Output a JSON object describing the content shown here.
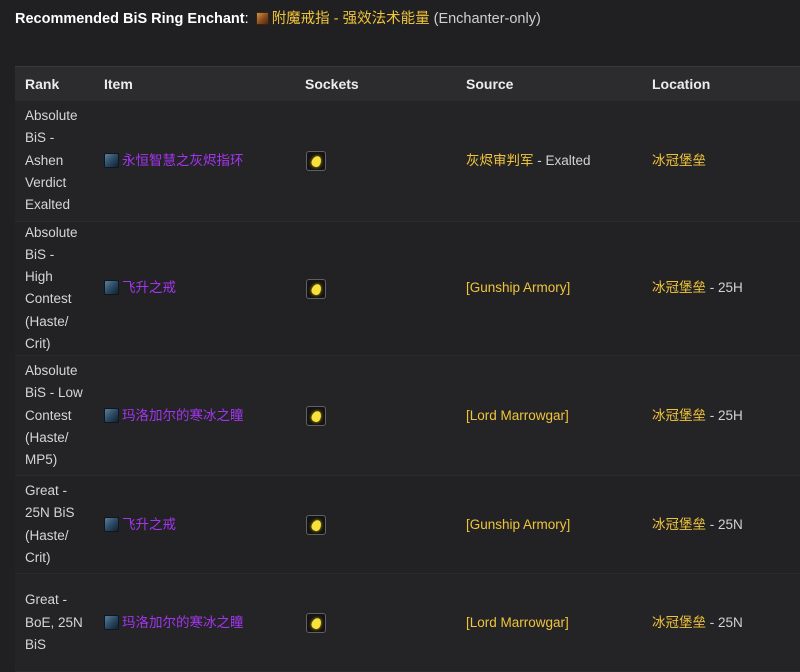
{
  "header": {
    "label": "Recommended BiS Ring Enchant",
    "colon": ":",
    "enchant_name": "附魔戒指 - 强效法术能量",
    "note": "(Enchanter-only)",
    "enchant_icon": "enchant-scroll-icon"
  },
  "table": {
    "columns": [
      "Rank",
      "Item",
      "Sockets",
      "Source",
      "Location"
    ],
    "rows": [
      {
        "rank": "Absolute BiS - Ashen Verdict Exalted",
        "item": "永恒智慧之灰烬指环",
        "socket_icon": "yellow-gem-socket-icon",
        "source_npc": "灰烬审判军",
        "source_rest": " - Exalted",
        "location_zone": "冰冠堡垒",
        "location_rest": ""
      },
      {
        "rank": "Absolute BiS - High Contest (Haste/ Crit)",
        "item": "飞升之戒",
        "socket_icon": "yellow-gem-socket-icon",
        "source_npc": "[Gunship Armory]",
        "source_rest": "",
        "location_zone": "冰冠堡垒",
        "location_rest": " - 25H"
      },
      {
        "rank": "Absolute BiS - Low Contest (Haste/ MP5)",
        "item": "玛洛加尔的寒冰之瞳",
        "socket_icon": "yellow-gem-socket-icon",
        "source_npc": "[Lord Marrowgar]",
        "source_rest": "",
        "location_zone": "冰冠堡垒",
        "location_rest": " - 25H"
      },
      {
        "rank": "Great - 25N BiS (Haste/ Crit)",
        "item": "飞升之戒",
        "socket_icon": "yellow-gem-socket-icon",
        "source_npc": "[Gunship Armory]",
        "source_rest": "",
        "location_zone": "冰冠堡垒",
        "location_rest": " - 25N"
      },
      {
        "rank": "Great - BoE, 25N BiS",
        "item": "玛洛加尔的寒冰之瞳",
        "socket_icon": "yellow-gem-socket-icon",
        "source_npc": "[Lord Marrowgar]",
        "source_rest": "",
        "location_zone": "冰冠堡垒",
        "location_rest": " - 25N"
      }
    ]
  }
}
